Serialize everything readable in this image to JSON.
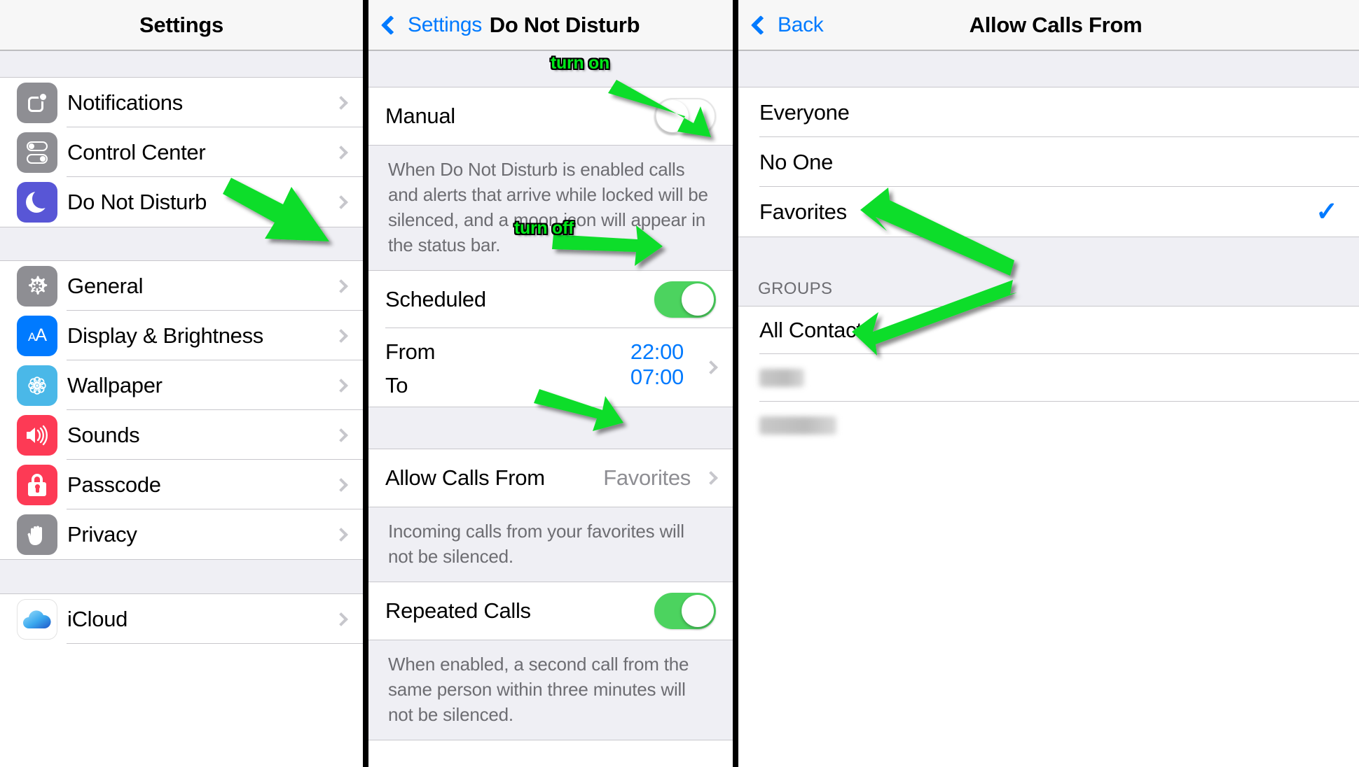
{
  "colors": {
    "accent_blue": "#007aff",
    "toggle_on_green": "#4cd35f",
    "annotation_green": "#00e818",
    "dnd_icon_purple": "#5856d6",
    "group_bg": "#efeff4"
  },
  "panel_settings": {
    "title": "Settings",
    "groups": [
      {
        "items": [
          {
            "label": "Notifications",
            "icon": "notifications-icon",
            "icon_color": "#8e8e93"
          },
          {
            "label": "Control Center",
            "icon": "control-center-icon",
            "icon_color": "#8e8e93"
          },
          {
            "label": "Do Not Disturb",
            "icon": "moon-icon",
            "icon_color": "#5856d6"
          }
        ]
      },
      {
        "items": [
          {
            "label": "General",
            "icon": "gear-icon",
            "icon_color": "#8e8e93"
          },
          {
            "label": "Display & Brightness",
            "icon": "text-size-icon",
            "icon_color": "#007aff"
          },
          {
            "label": "Wallpaper",
            "icon": "flower-icon",
            "icon_color": "#4ab8e8"
          },
          {
            "label": "Sounds",
            "icon": "speaker-icon",
            "icon_color": "#fd3a55"
          },
          {
            "label": "Passcode",
            "icon": "lock-icon",
            "icon_color": "#fd3a55"
          },
          {
            "label": "Privacy",
            "icon": "hand-icon",
            "icon_color": "#8e8e93"
          }
        ]
      },
      {
        "items": [
          {
            "label": "iCloud",
            "icon": "icloud-icon",
            "icon_color": "#ffffff"
          }
        ]
      }
    ]
  },
  "panel_dnd": {
    "back_label": "Settings",
    "title": "Do Not Disturb",
    "manual": {
      "label": "Manual",
      "toggle_state": "off"
    },
    "manual_footer": "When Do Not Disturb is enabled calls and alerts that arrive while locked will be silenced, and a moon icon will appear in the status bar.",
    "scheduled": {
      "label": "Scheduled",
      "toggle_state": "on"
    },
    "schedule_times": {
      "from_label": "From",
      "from_value": "22:00",
      "to_label": "To",
      "to_value": "07:00"
    },
    "allow_calls": {
      "label": "Allow Calls From",
      "value": "Favorites"
    },
    "allow_calls_footer": "Incoming calls from your favorites will not be silenced.",
    "repeated_calls": {
      "label": "Repeated Calls",
      "toggle_state": "on"
    },
    "repeated_calls_footer": "When enabled, a second call from the same person within three minutes will not be silenced."
  },
  "panel_calls": {
    "back_label": "Back",
    "title": "Allow Calls From",
    "options": [
      {
        "label": "Everyone",
        "selected": false
      },
      {
        "label": "No One",
        "selected": false
      },
      {
        "label": "Favorites",
        "selected": true
      }
    ],
    "checkmark_glyph": "✓",
    "groups_header": "GROUPS",
    "group_items": [
      {
        "label": "All Contacts",
        "redacted": false
      },
      {
        "label": "",
        "redacted": true
      },
      {
        "label": "",
        "redacted": true
      }
    ]
  },
  "annotations": [
    {
      "id": "turn-on",
      "text": "turn on"
    },
    {
      "id": "turn-off",
      "text": "turn off"
    }
  ]
}
